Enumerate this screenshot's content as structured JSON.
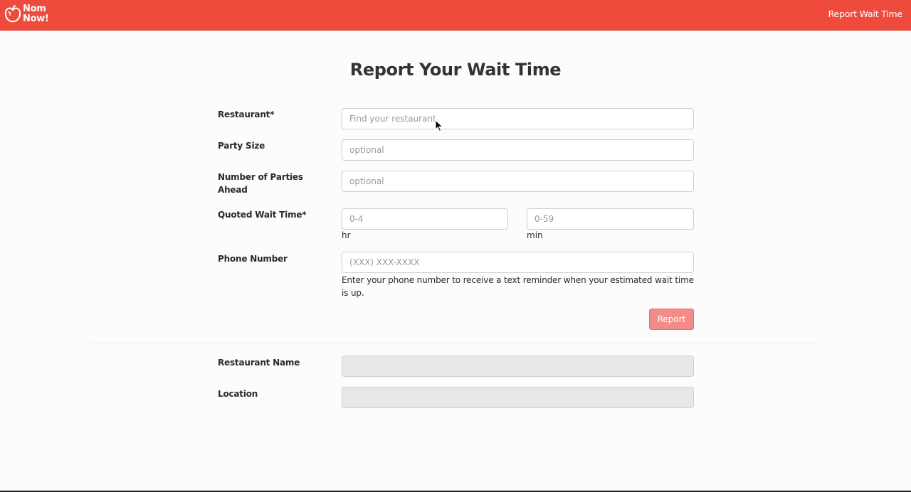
{
  "navbar": {
    "brand_text": "Nom\nNow!",
    "brand_icon": "apple-icon",
    "link_label": "Report Wait Time",
    "color": "#ef4b3c"
  },
  "page": {
    "title": "Report Your Wait Time"
  },
  "form": {
    "restaurant": {
      "label": "Restaurant*",
      "placeholder": "Find your restaurant",
      "value": ""
    },
    "party_size": {
      "label": "Party Size",
      "placeholder": "optional",
      "value": ""
    },
    "parties_ahead": {
      "label": "Number of Parties Ahead",
      "placeholder": "optional",
      "value": ""
    },
    "quoted_wait": {
      "label": "Quoted Wait Time*",
      "hours_placeholder": "0-4",
      "hours_unit": "hr",
      "minutes_placeholder": "0-59",
      "minutes_unit": "min"
    },
    "phone": {
      "label": "Phone Number",
      "placeholder": "(XXX) XXX-XXXX",
      "help_text": "Enter your phone number to receive a text reminder when your estimated wait time is up."
    },
    "submit_label": "Report",
    "submit_color": "#f28c86"
  },
  "details": {
    "restaurant_name_label": "Restaurant Name",
    "restaurant_name_value": "",
    "location_label": "Location",
    "location_value": ""
  }
}
